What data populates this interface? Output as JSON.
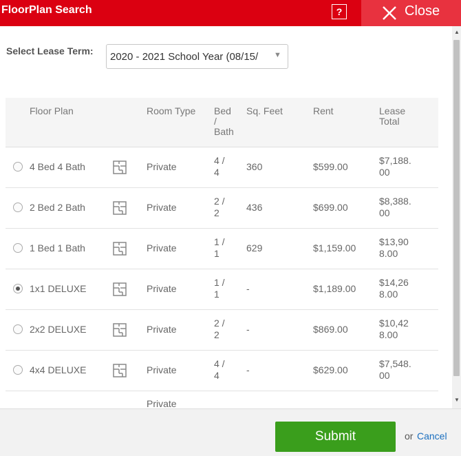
{
  "header": {
    "title": "FloorPlan Search",
    "help_label": "?",
    "close_label": "Close"
  },
  "lease": {
    "label": "Select Lease Term:",
    "selected": "2020 - 2021 School Year (08/15/"
  },
  "table": {
    "columns": {
      "floor_plan": "Floor Plan",
      "room_type": "Room Type",
      "bed_bath_1": "Bed",
      "bed_bath_2": "/",
      "bed_bath_3": "Bath",
      "sq_feet": "Sq. Feet",
      "rent": "Rent",
      "lease_total_1": "Lease",
      "lease_total_2": "Total"
    },
    "rows": [
      {
        "name": "4 Bed 4 Bath",
        "room_type": "Private",
        "bed": "4 /",
        "bath": "4",
        "sqft": "360",
        "rent": "$599.00",
        "total_1": "$7,188.",
        "total_2": "00",
        "selected": false
      },
      {
        "name": "2 Bed 2 Bath",
        "room_type": "Private",
        "bed": "2 /",
        "bath": "2",
        "sqft": "436",
        "rent": "$699.00",
        "total_1": "$8,388.",
        "total_2": "00",
        "selected": false
      },
      {
        "name": "1 Bed 1 Bath",
        "room_type": "Private",
        "bed": "1 /",
        "bath": "1",
        "sqft": "629",
        "rent": "$1,159.00",
        "total_1": "$13,90",
        "total_2": "8.00",
        "selected": false
      },
      {
        "name": "1x1 DELUXE",
        "room_type": "Private",
        "bed": "1 /",
        "bath": "1",
        "sqft": "-",
        "rent": "$1,189.00",
        "total_1": "$14,26",
        "total_2": "8.00",
        "selected": true
      },
      {
        "name": "2x2 DELUXE",
        "room_type": "Private",
        "bed": "2 /",
        "bath": "2",
        "sqft": "-",
        "rent": "$869.00",
        "total_1": "$10,42",
        "total_2": "8.00",
        "selected": false
      },
      {
        "name": "4x4 DELUXE",
        "room_type": "Private",
        "bed": "4 /",
        "bath": "4",
        "sqft": "-",
        "rent": "$629.00",
        "total_1": "$7,548.",
        "total_2": "00",
        "selected": false
      },
      {
        "name": "",
        "room_type": "Private",
        "bed": "",
        "bath": "",
        "sqft": "",
        "rent": "",
        "total_1": "",
        "total_2": "",
        "selected": false
      }
    ]
  },
  "footer": {
    "submit_label": "Submit",
    "or_text": "or",
    "cancel_label": "Cancel"
  },
  "icons": {
    "close": "close-icon",
    "floorplan": "floorplan-icon",
    "scroll_up": "arrow-up-icon",
    "scroll_down": "arrow-down-icon"
  },
  "colors": {
    "header_bg": "#db0011",
    "close_bg": "#e8323f",
    "submit_bg": "#3a9e1c",
    "link": "#1b6fbf"
  }
}
